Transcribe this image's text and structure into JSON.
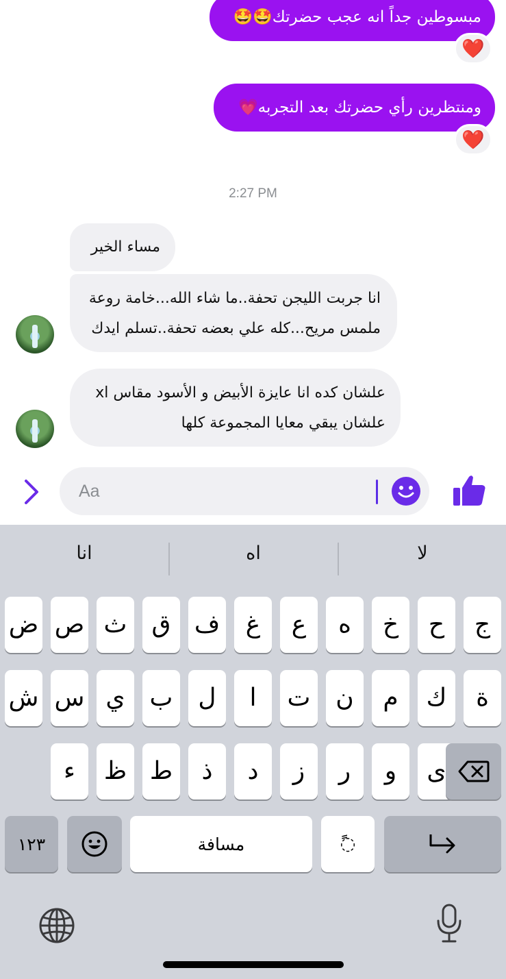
{
  "conversation": {
    "outgoing": [
      {
        "text": "مبسوطين جداً انه عجب حضرتك🤩🤩",
        "reaction": "❤️"
      },
      {
        "text": "ومنتظرين رأي حضرتك بعد التجربه💗",
        "reaction": "❤️"
      }
    ],
    "timestamp": "2:27 PM",
    "incoming": [
      {
        "lines": [
          "مساء الخير"
        ]
      },
      {
        "lines": [
          "انا جربت الليجن تحفة..ما شاء الله...خامة روعة",
          "ملمس مريح...كله علي بعضه تحفة..تسلم ايدك"
        ]
      },
      {
        "lines": [
          "علشان كده انا عايزة الأبيض و الأسود مقاس xl",
          "علشان يبقي معايا المجموعة كلها"
        ]
      }
    ]
  },
  "composer": {
    "placeholder": "Aa",
    "expand_icon": "chevron-right-icon",
    "emoji_icon": "smiley-icon",
    "send_icon": "thumbs-up-icon",
    "accent": "#6a2be8"
  },
  "keyboard": {
    "suggestions": [
      "لا",
      "اه",
      "انا"
    ],
    "rows": [
      [
        "ج",
        "ح",
        "خ",
        "ه",
        "ع",
        "غ",
        "ف",
        "ق",
        "ث",
        "ص",
        "ض"
      ],
      [
        "ة",
        "ك",
        "م",
        "ن",
        "ت",
        "ا",
        "ل",
        "ب",
        "ي",
        "س",
        "ش"
      ],
      [
        "ى",
        "و",
        "ر",
        "ز",
        "د",
        "ذ",
        "ط",
        "ظ",
        "ء"
      ]
    ],
    "numbers_key": "١٢٣",
    "space_key": "مسافة",
    "diacritic_key": "ًً◌",
    "return_icon": "return-arrow-icon",
    "delete_icon": "delete-icon",
    "emoji_icon": "emoji-icon",
    "globe_icon": "globe-icon",
    "mic_icon": "microphone-icon"
  },
  "colors": {
    "outgoing_bubble": "#9a12f0",
    "incoming_bubble": "#f0f0f3",
    "heart": "#e0102a",
    "keyboard_bg": "#d1d4db"
  }
}
